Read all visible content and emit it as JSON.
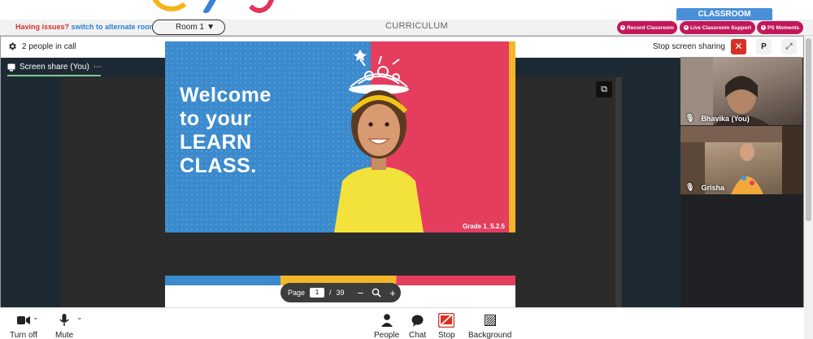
{
  "topbar": {
    "issue_prefix": "Having issues?",
    "issue_link": "switch to alternate room",
    "room_select": "Room 1",
    "curriculum": "CURRICULUM",
    "classroom_tab": "CLASSROOM",
    "pills": {
      "record": "Record Classroom",
      "live_support": "Live Classroom Support",
      "ps_moments": "PS Moments"
    }
  },
  "meet_header": {
    "people_count": "2 people in call",
    "stop_sharing": "Stop screen sharing",
    "p_label": "P"
  },
  "share_tab": {
    "label": "Screen share (You)",
    "more": "⋯"
  },
  "slide": {
    "line1": "Welcome",
    "line2": "to your",
    "line3": "LEARN",
    "line4": "CLASS.",
    "grade": "Grade 1_5.2.5"
  },
  "pager": {
    "page_label": "Page",
    "current": "1",
    "separator": "/",
    "total": "39",
    "zoom_out": "−",
    "zoom_in": "+"
  },
  "participants": [
    {
      "name": "Bhavika (You)"
    },
    {
      "name": "Grisha"
    }
  ],
  "controls": {
    "camera": "Turn off",
    "mic": "Mute",
    "people": "People",
    "chat": "Chat",
    "stop": "Stop",
    "background": "Background"
  },
  "colors": {
    "accent_red": "#d93025",
    "pill_magenta": "#c2185b",
    "classroom_blue": "#4a90d9",
    "slide_blue": "#3a8acd",
    "slide_red": "#e43d5e",
    "slide_yellow": "#f4b629",
    "active_tab_green": "#81c995"
  },
  "icons": {
    "settings": "gear-icon",
    "close": "close-icon",
    "fullscreen": "expand-icon",
    "present": "present-icon",
    "open_external": "open-external-icon",
    "camera": "camera-icon",
    "mic": "mic-icon",
    "people": "person-icon",
    "chat": "chat-icon",
    "stop_share": "stop-share-icon",
    "background": "background-icon"
  }
}
